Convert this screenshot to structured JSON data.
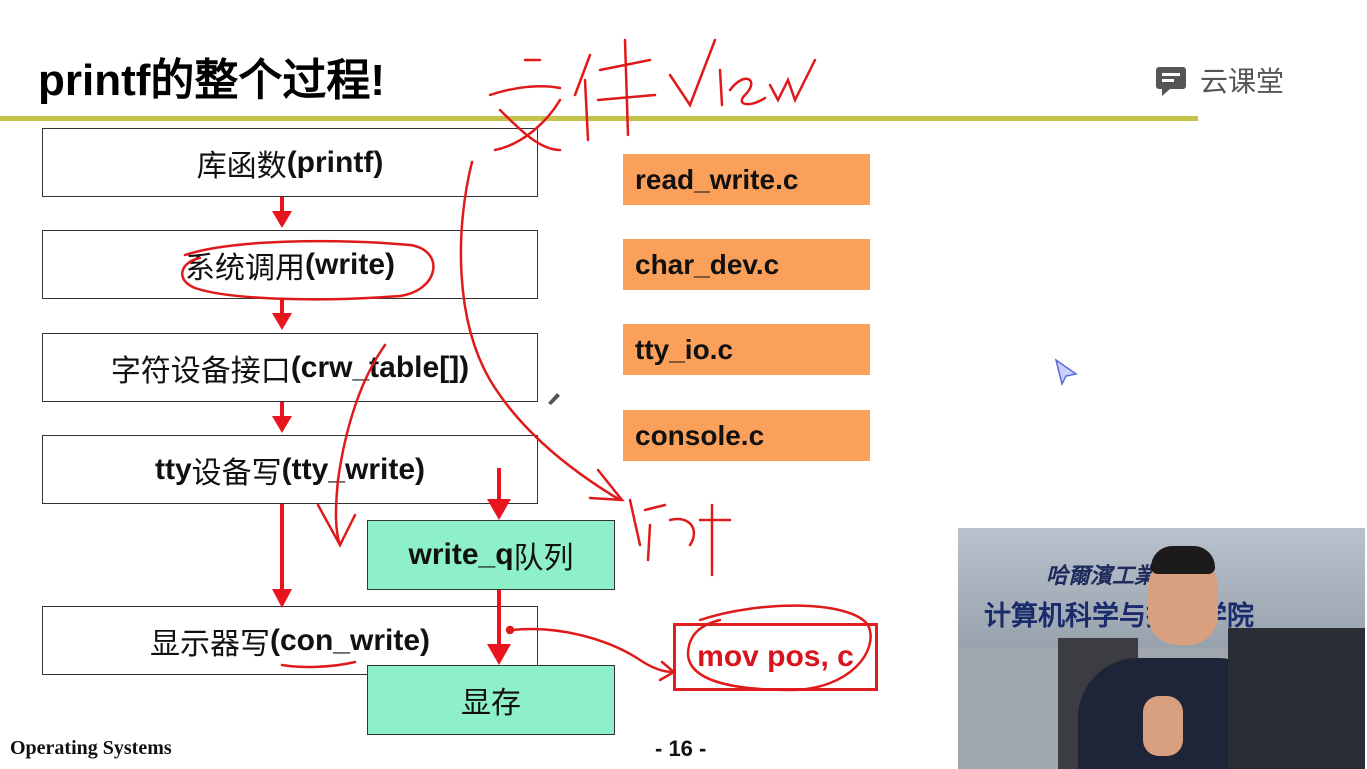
{
  "slide": {
    "title": "printf的整个过程!",
    "logo_text": "云课堂",
    "footer_left": "Operating Systems",
    "page_number": "- 16 -"
  },
  "flow": {
    "library": {
      "cn": "库函数",
      "code": "(printf)"
    },
    "syscall": {
      "cn": "系统调用",
      "code": "(write)"
    },
    "chardev": {
      "cn": "字符设备接口",
      "code": "(crw_table[])"
    },
    "tty": {
      "code_pre": "tty",
      "cn": "设备写",
      "code": "(tty_write)"
    },
    "writeq": {
      "code": "write_q",
      "cn": "队列"
    },
    "display": {
      "cn": "显示器写",
      "code": "(con_write)"
    },
    "vram": {
      "cn": "显存"
    }
  },
  "files": [
    "read_write.c",
    "char_dev.c",
    "tty_io.c",
    "console.c"
  ],
  "annotation": {
    "mov": "mov pos, c",
    "handwriting_top": "文件view",
    "handwriting_mid": "驱动"
  },
  "video": {
    "banner_line1": "哈爾濱工業",
    "banner_line2": "计算机科学与技术学院"
  },
  "colors": {
    "accent_rule": "#c5c24a",
    "file_box": "#fba05a",
    "queue_box": "#8ef0c8",
    "arrow": "#e8141e",
    "ink": "#d8141e"
  }
}
